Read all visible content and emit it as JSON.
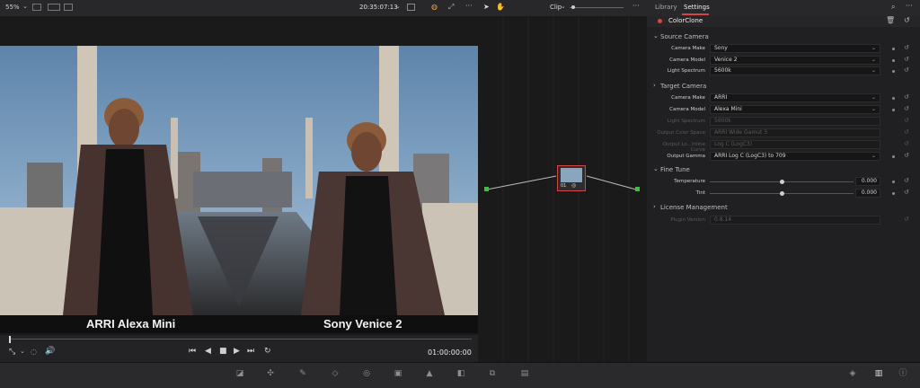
{
  "viewer": {
    "zoom": "55%",
    "timecode_top": "20:35:07:13",
    "left_caption": "ARRI Alexa Mini",
    "right_caption": "Sony Venice 2",
    "timecode_bottom": "01:00:00:00"
  },
  "nodes": {
    "mode_label": "Clip",
    "node_number": "01"
  },
  "settings": {
    "tabs": [
      "Library",
      "Settings"
    ],
    "active_tab": "Settings",
    "plugin_title": "ColorClone",
    "source_camera": {
      "heading": "Source Camera",
      "rows": [
        {
          "label": "Camera Make",
          "value": "Sony"
        },
        {
          "label": "Camera Model",
          "value": "Venice 2"
        },
        {
          "label": "Light Spectrum",
          "value": "5600k"
        }
      ]
    },
    "target_camera": {
      "heading": "Target Camera",
      "rows": [
        {
          "label": "Camera Make",
          "value": "ARRI"
        },
        {
          "label": "Camera Model",
          "value": "Alexa Mini"
        },
        {
          "label": "Light Spectrum",
          "value": "5600k"
        },
        {
          "label": "Output Color Space",
          "value": "ARRI Wide Gamut 3"
        },
        {
          "label": "Output Lo...Inline Curve",
          "value": "Log C (LogC3)"
        },
        {
          "label": "Output Gamma",
          "value": "ARRI Log C (LogC3) to 709"
        }
      ]
    },
    "fine_tune": {
      "heading": "Fine Tune",
      "temperature_label": "Temperature",
      "temperature_value": "0.000",
      "temperature_level": 0.5,
      "tint_label": "Tint",
      "tint_value": "0.000",
      "tint_level": 0.5
    },
    "license": {
      "heading": "License Management",
      "plugin_version_label": "Plugin Version",
      "plugin_version_value": "0.8.14"
    }
  },
  "colors": {
    "accent_red": "#d64545",
    "sky_blue": "#9fc0da",
    "node_green": "#3fbf3f"
  }
}
